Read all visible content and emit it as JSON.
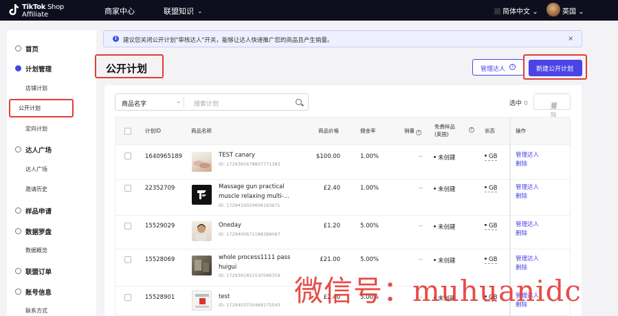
{
  "header": {
    "logo_line1_bold": "TikTok",
    "logo_line1_rest": " Shop",
    "logo_line2": "Affiliate",
    "nav": [
      "商家中心",
      "联盟知识"
    ],
    "language": "简体中文",
    "region": "英国"
  },
  "sidebar": {
    "items": [
      {
        "label": "首页",
        "icon": "home-icon"
      },
      {
        "label": "计划管理",
        "icon": "plan-icon"
      },
      {
        "label": "店铺计划"
      },
      {
        "label": "公开计划",
        "active": true
      },
      {
        "label": "定向计划"
      },
      {
        "label": "达人广场",
        "icon": "creator-icon"
      },
      {
        "label": "达人广场"
      },
      {
        "label": "邀请历史"
      },
      {
        "label": "样品申请",
        "icon": "sample-icon"
      },
      {
        "label": "数据罗盘",
        "icon": "compass-icon"
      },
      {
        "label": "数据概览"
      },
      {
        "label": "联盟订单",
        "icon": "order-icon"
      },
      {
        "label": "账号信息",
        "icon": "account-icon"
      },
      {
        "label": "联系方式"
      }
    ]
  },
  "notice": {
    "text": "建议您关闭公开计划\"审核达人\"开关，能够让达人快速推广您的商品且产生销量。",
    "close": "×"
  },
  "page": {
    "title": "公开计划",
    "manage_button": "管理达人",
    "new_button": "新建公开计划"
  },
  "filter": {
    "select_value": "商品名字",
    "search_placeholder": "搜索计划",
    "selected_label": "选中",
    "selected_count": "0",
    "delete_button": "删除"
  },
  "table": {
    "headers": {
      "id": "计划ID",
      "name": "商品名称",
      "price": "商品价格",
      "rate": "佣金率",
      "sales": "销量",
      "sample_line1": "免费样品",
      "sample_line2": "(英国)",
      "status": "状态",
      "ops": "操作"
    },
    "rows": [
      {
        "id": "1640965189",
        "name1": "TEST canary",
        "name2": "",
        "pid": "ID: 1729391678807771383",
        "price": "$100.00",
        "rate": "1.00%",
        "sales": "--",
        "sample": "未创建",
        "status": "GB",
        "op1": "管理达人",
        "op2": "删除",
        "thumb": "shoes"
      },
      {
        "id": "22352709",
        "name1": "Massage gun practical",
        "name2": "muscle relaxing multi-...",
        "pid": "ID: 1729410020606183671",
        "price": "£2.40",
        "rate": "1.00%",
        "sales": "--",
        "sample": "未创建",
        "status": "GB",
        "op1": "管理达人",
        "op2": "删除",
        "thumb": "logo"
      },
      {
        "id": "15529029",
        "name1": "Oneday",
        "name2": "",
        "pid": "ID: 1729400671188388087",
        "price": "£1.20",
        "rate": "5.00%",
        "sales": "--",
        "sample": "未创建",
        "status": "GB",
        "op1": "管理达人",
        "op2": "删除",
        "thumb": "portrait"
      },
      {
        "id": "15528069",
        "name1": "whole process1111 pass",
        "name2": "huigui",
        "pid": "ID: 1729391851530586359",
        "price": "£21.00",
        "rate": "5.00%",
        "sales": "--",
        "sample": "未创建",
        "status": "GB",
        "op1": "管理达人",
        "op2": "删除",
        "thumb": "photo"
      },
      {
        "id": "15528901",
        "name1": "test",
        "name2": "",
        "pid": "ID: 1729403750469175543",
        "price": "£2.40",
        "rate": "5.00%",
        "sales": "--",
        "sample": "未创建",
        "status": "GB",
        "op1": "管理达人",
        "op2": "删除",
        "thumb": "doc"
      }
    ]
  },
  "watermark": "微信号：muhuanidc",
  "colors": {
    "accent": "#4a44e6",
    "highlight": "#e53935",
    "topbar": "#0e0e1e"
  }
}
